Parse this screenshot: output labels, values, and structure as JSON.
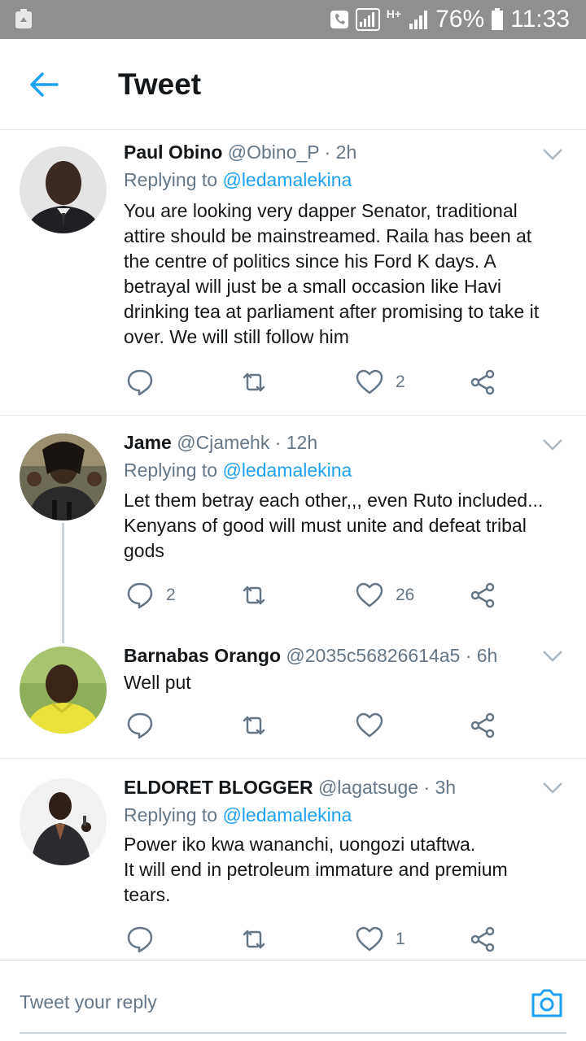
{
  "status_bar": {
    "battery": "76%",
    "time": "11:33",
    "network": "H+"
  },
  "header": {
    "title": "Tweet"
  },
  "tweets": [
    {
      "name": "Paul Obino",
      "handle": "@Obino_P · 2h",
      "replying_prefix": "Replying to",
      "replying_to": "@ledamalekina",
      "lines": [
        "You are looking very dapper Senator, traditional",
        "attire should be mainstreamed.  Raila has been at",
        "the centre of politics since his Ford K days. A",
        "betrayal will just be a small occasion like Havi",
        "drinking tea at parliament after promising to take it",
        "over. We will still follow him"
      ],
      "reply_count": "",
      "retweet_count": "",
      "like_count": "2"
    },
    {
      "name": "Jame",
      "handle": "@Cjamehk · 12h",
      "replying_prefix": "Replying to",
      "replying_to": "@ledamalekina",
      "lines": [
        "Let them betray each other,,, even Ruto included...",
        "Kenyans of good will must unite and defeat tribal",
        "gods"
      ],
      "reply_count": "2",
      "retweet_count": "",
      "like_count": "26"
    },
    {
      "name": "Barnabas Orango",
      "handle": "@2035c56826614a5 · 6h",
      "lines": [
        "Well put"
      ],
      "reply_count": "",
      "retweet_count": "",
      "like_count": ""
    },
    {
      "name": "ELDORET BLOGGER",
      "handle": "@lagatsuge · 3h",
      "replying_prefix": "Replying to",
      "replying_to": "@ledamalekina",
      "lines": [
        "Power iko kwa wananchi, uongozi utaftwa.",
        "It will end in petroleum immature and premium",
        "tears."
      ],
      "reply_count": "",
      "retweet_count": "",
      "like_count": "1"
    }
  ],
  "composer": {
    "placeholder": "Tweet your reply"
  },
  "colors": {
    "accent": "#1da1f2",
    "muted": "#657786",
    "text": "#14171a",
    "divider": "#e1e8ed"
  }
}
